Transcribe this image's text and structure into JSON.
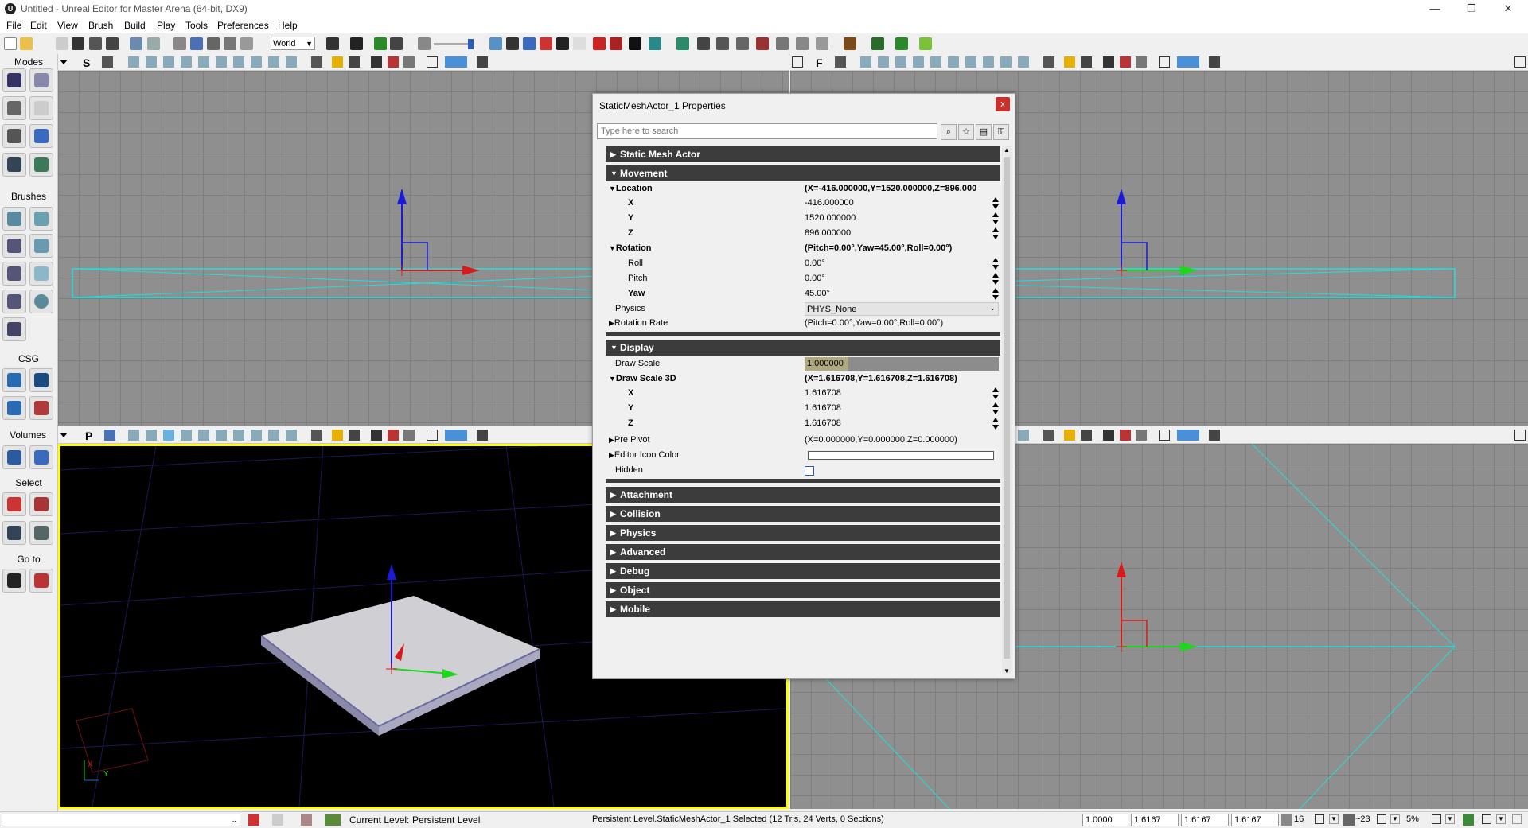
{
  "window": {
    "title": "Untitled - Unreal Editor for Master Arena (64-bit, DX9)",
    "app_icon": "U",
    "minimize": "—",
    "maximize": "❐",
    "close": "✕"
  },
  "menu": [
    "File",
    "Edit",
    "View",
    "Brush",
    "Build",
    "Play",
    "Tools",
    "Preferences",
    "Help"
  ],
  "toolbar": {
    "coord_system": "World"
  },
  "modes_panel": {
    "modes_label": "Modes",
    "brushes_label": "Brushes",
    "csg_label": "CSG",
    "volumes_label": "Volumes",
    "select_label": "Select",
    "goto_label": "Go to"
  },
  "viewports": {
    "top_left_mode": "S",
    "top_right_mode": "F",
    "bottom_left_mode": "P",
    "perspective_axis_x": "X",
    "perspective_axis_y": "Y"
  },
  "properties": {
    "title": "StaticMeshActor_1 Properties",
    "close": "x",
    "search_placeholder": "Type here to search",
    "categories": {
      "static_mesh_actor": "Static Mesh Actor",
      "movement": "Movement",
      "display": "Display",
      "attachment": "Attachment",
      "collision": "Collision",
      "physics": "Physics",
      "advanced": "Advanced",
      "debug": "Debug",
      "object": "Object",
      "mobile": "Mobile"
    },
    "movement": {
      "location_label": "Location",
      "location_value": "(X=-416.000000,Y=1520.000000,Z=896.000",
      "x_label": "X",
      "x_value": "-416.000000",
      "y_label": "Y",
      "y_value": "1520.000000",
      "z_label": "Z",
      "z_value": "896.000000",
      "rotation_label": "Rotation",
      "rotation_value": "(Pitch=0.00°,Yaw=45.00°,Roll=0.00°)",
      "roll_label": "Roll",
      "roll_value": "0.00°",
      "pitch_label": "Pitch",
      "pitch_value": "0.00°",
      "yaw_label": "Yaw",
      "yaw_value": "45.00°",
      "physics_label": "Physics",
      "physics_value": "PHYS_None",
      "rotation_rate_label": "Rotation Rate",
      "rotation_rate_value": "(Pitch=0.00°,Yaw=0.00°,Roll=0.00°)"
    },
    "display": {
      "draw_scale_label": "Draw Scale",
      "draw_scale_value": "1.000000",
      "draw_scale_3d_label": "Draw Scale 3D",
      "draw_scale_3d_value": "(X=1.616708,Y=1.616708,Z=1.616708)",
      "x_label": "X",
      "x_value": "1.616708",
      "y_label": "Y",
      "y_value": "1.616708",
      "z_label": "Z",
      "z_value": "1.616708",
      "pre_pivot_label": "Pre Pivot",
      "pre_pivot_value": "(X=0.000000,Y=0.000000,Z=0.000000)",
      "editor_icon_color_label": "Editor Icon Color",
      "hidden_label": "Hidden"
    }
  },
  "status_bar": {
    "current_level_label": "Current Level:",
    "current_level_value": "Persistent Level",
    "selection_info": "Persistent Level.StaticMeshActor_1 Selected (12 Tris, 24 Verts, 0 Sections)",
    "scale_fields": [
      "1.0000",
      "1.6167",
      "1.6167",
      "1.6167"
    ],
    "grid_size": "16",
    "rotation_snap": "~23",
    "scale_snap": "5%"
  }
}
